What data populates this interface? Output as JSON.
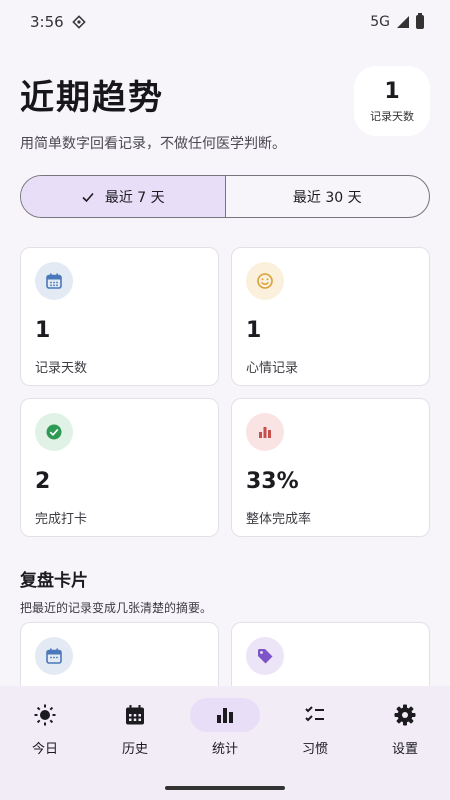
{
  "status": {
    "time": "3:56",
    "network": "5G"
  },
  "header": {
    "title": "近期趋势",
    "subtitle": "用简单数字回看记录，不做任何医学判断。",
    "badge_value": "1",
    "badge_label": "记录天数"
  },
  "range": {
    "option_7": "最近 7 天",
    "option_30": "最近 30 天",
    "selected": "option_7"
  },
  "stats": [
    {
      "value": "1",
      "label": "记录天数",
      "icon": "calendar-icon",
      "icon_bg": "#e3eaf4",
      "icon_color": "#4a78b8"
    },
    {
      "value": "1",
      "label": "心情记录",
      "icon": "smiley-icon",
      "icon_bg": "#fbf0dc",
      "icon_color": "#d9a13a"
    },
    {
      "value": "2",
      "label": "完成打卡",
      "icon": "check-circle-icon",
      "icon_bg": "#e0f2e5",
      "icon_color": "#2f9a55"
    },
    {
      "value": "33%",
      "label": "整体完成率",
      "icon": "bar-chart-icon",
      "icon_bg": "#f9e4e3",
      "icon_color": "#c8504c"
    }
  ],
  "review": {
    "title": "复盘卡片",
    "subtitle": "把最近的记录变成几张清楚的摘要。"
  },
  "nav": [
    {
      "label": "今日",
      "icon": "sun-icon"
    },
    {
      "label": "历史",
      "icon": "calendar-icon"
    },
    {
      "label": "统计",
      "icon": "bar-chart-icon",
      "active": true
    },
    {
      "label": "习惯",
      "icon": "checklist-icon"
    },
    {
      "label": "设置",
      "icon": "gear-icon"
    }
  ]
}
